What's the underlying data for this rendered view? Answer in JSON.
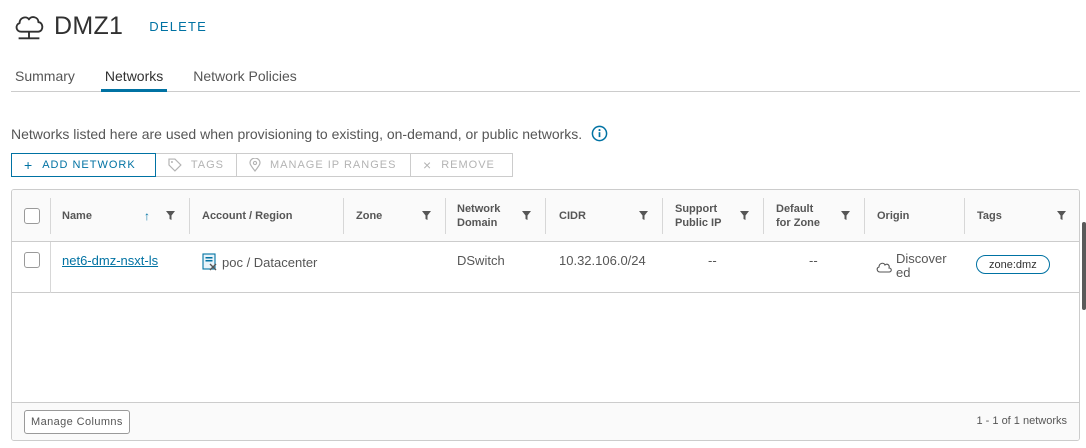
{
  "header": {
    "title": "DMZ1",
    "delete_label": "DELETE",
    "icon": "cloud-network-icon"
  },
  "tabs": [
    {
      "label": "Summary",
      "active": false
    },
    {
      "label": "Networks",
      "active": true
    },
    {
      "label": "Network Policies",
      "active": false
    }
  ],
  "description": "Networks listed here are used when provisioning to existing, on-demand, or public networks.",
  "toolbar": {
    "add_network": "ADD NETWORK",
    "tags": "TAGS",
    "manage_ip_ranges": "MANAGE IP RANGES",
    "remove": "REMOVE"
  },
  "grid": {
    "columns": {
      "name": "Name",
      "account_region": "Account / Region",
      "zone": "Zone",
      "network_domain_line1": "Network",
      "network_domain_line2": "Domain",
      "cidr": "CIDR",
      "support_public_ip_line1": "Support",
      "support_public_ip_line2": "Public IP",
      "default_for_zone_line1": "Default",
      "default_for_zone_line2": "for Zone",
      "origin": "Origin",
      "tags": "Tags"
    },
    "rows": [
      {
        "name": "net6-dmz-nsxt-ls",
        "account_region": "poc / Datacenter",
        "zone": "",
        "network_domain": "DSwitch",
        "cidr": "10.32.106.0/24",
        "support_public_ip": "--",
        "default_for_zone": "--",
        "origin_line1": "Discover",
        "origin_line2": "ed",
        "tag": "zone:dmz"
      }
    ],
    "footer": {
      "manage_columns": "Manage Columns",
      "count": "1 - 1 of 1 networks"
    }
  },
  "colors": {
    "accent": "#0072a3",
    "text": "#313131",
    "muted": "#565656",
    "border": "#cccccc"
  }
}
